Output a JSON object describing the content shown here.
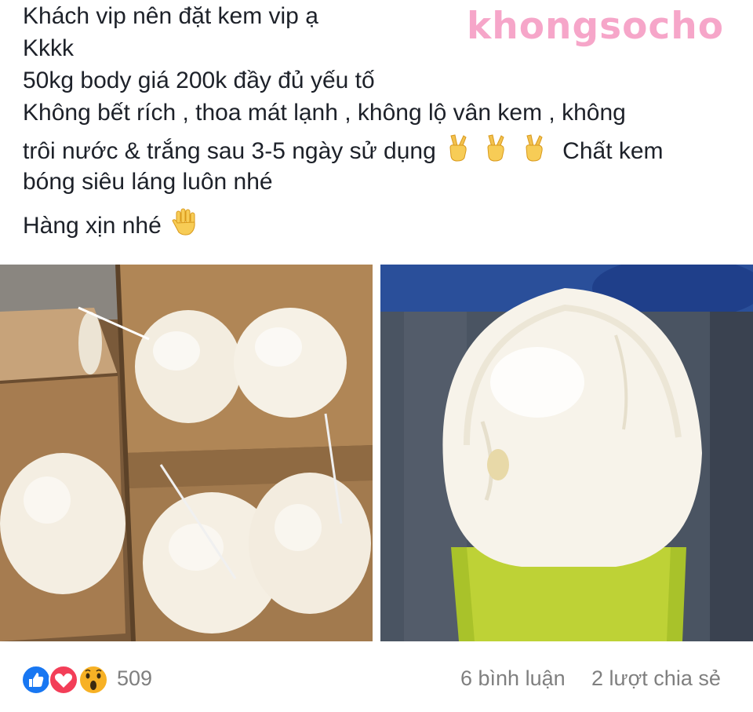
{
  "post": {
    "lines": [
      "Khách vip nên đặt kem vip ạ",
      "Kkkk",
      "50kg body giá 200k đầy đủ yếu tố",
      "Không bết rích , thoa mát lạnh , không lộ vân kem , không",
      "trôi nước & trắng sau 3-5 ngày sử dụng",
      "Chất kem",
      "bóng siêu láng luôn nhé",
      "Hàng xịn nhé"
    ]
  },
  "watermark": "khongsocho",
  "reactions": {
    "count": "509",
    "icons": [
      "like-icon",
      "love-icon",
      "wow-icon"
    ],
    "comments": "6 bình luận",
    "shares": "2 lượt chia sẻ"
  },
  "colors": {
    "watermark": "#f6a6c9",
    "like": "#1877f2",
    "love": "#f33e58",
    "wow": "#f7b125",
    "meta_text": "#7f7f7f"
  }
}
